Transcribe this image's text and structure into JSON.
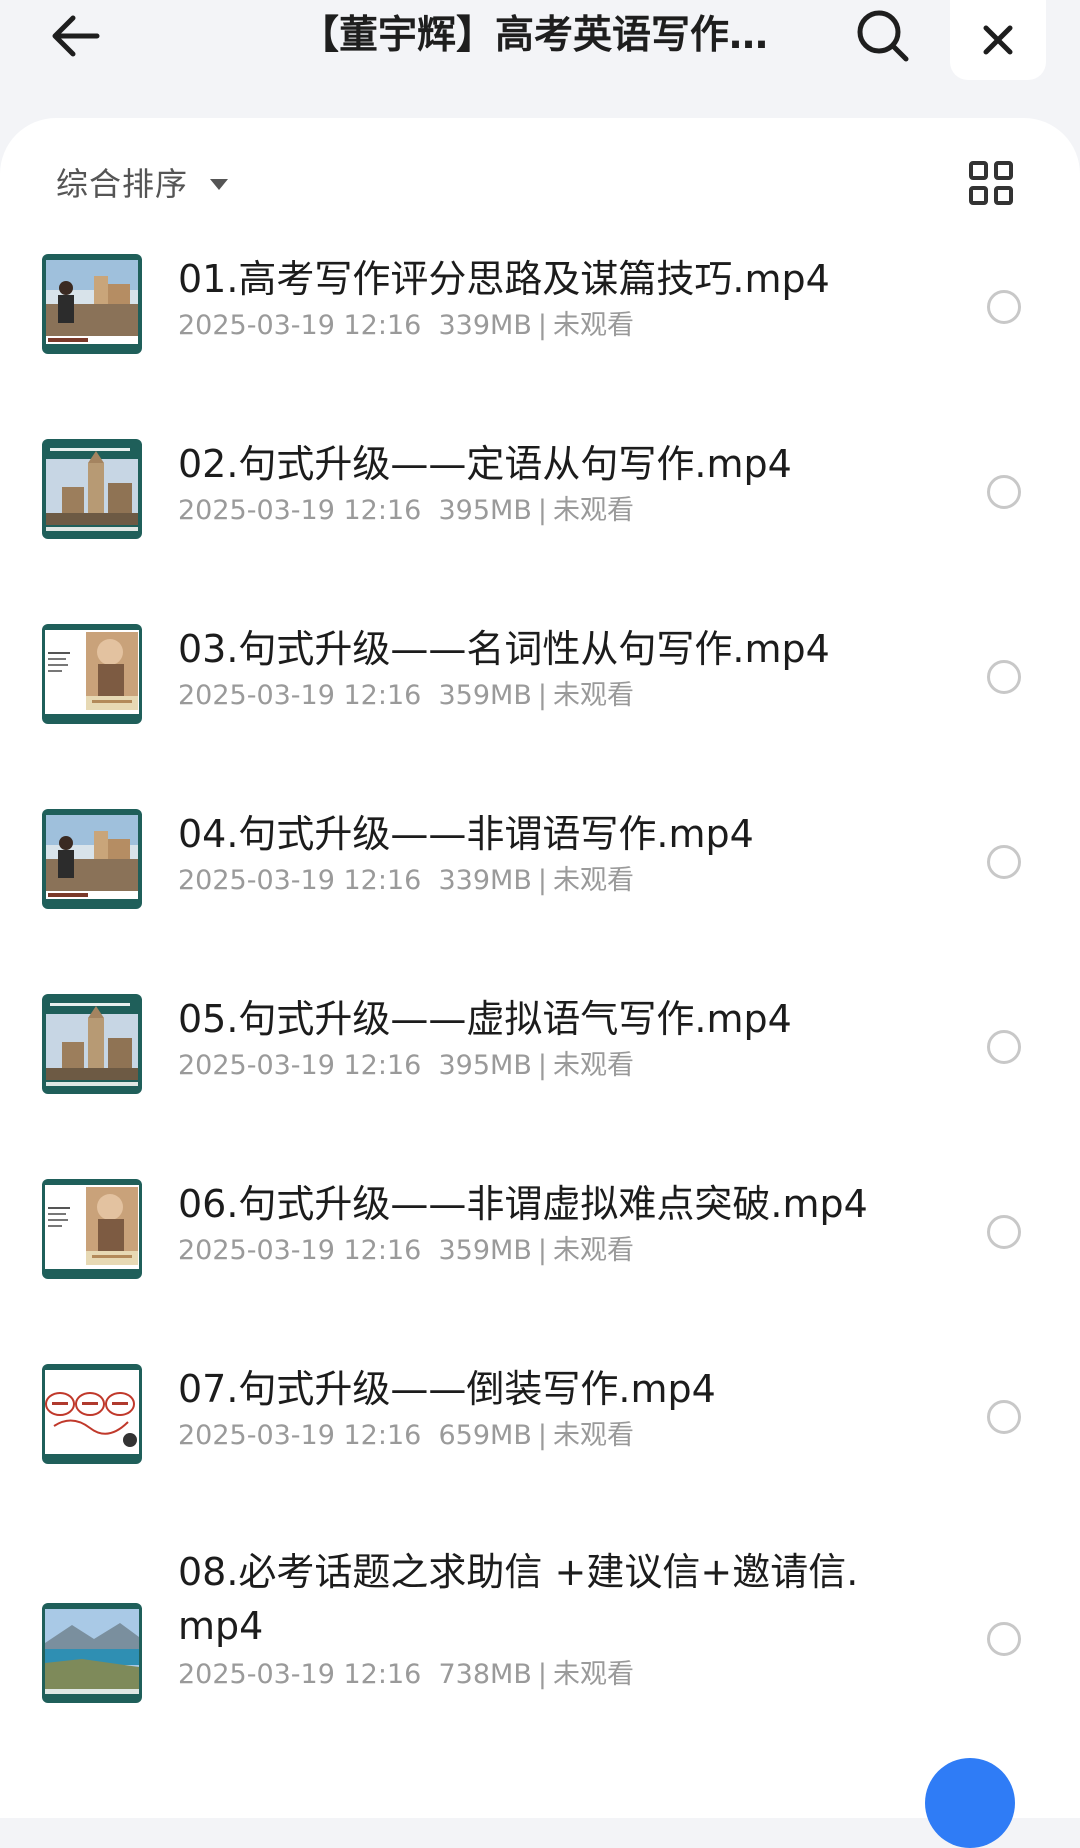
{
  "header": {
    "title": "【董宇辉】高考英语写作素材课",
    "back_icon": "back-arrow-icon",
    "search_icon": "search-icon",
    "close_icon": "close-icon"
  },
  "toolbar": {
    "sort_label": "综合排序",
    "sort_icon": "caret-down-icon",
    "view_icon": "grid-view-icon"
  },
  "files": [
    {
      "name": "01.高考写作评分思路及谋篇技巧.mp4",
      "date": "2025-03-19 12:16",
      "size": "339MB",
      "status": "未观看",
      "thumb": "teal-castle"
    },
    {
      "name": "02.句式升级——定语从句写作.mp4",
      "date": "2025-03-19 12:16",
      "size": "395MB",
      "status": "未观看",
      "thumb": "teal-cathedral"
    },
    {
      "name": "03.句式升级——名词性从句写作.mp4",
      "date": "2025-03-19 12:16",
      "size": "359MB",
      "status": "未观看",
      "thumb": "white-portrait"
    },
    {
      "name": "04.句式升级——非谓语写作.mp4",
      "date": "2025-03-19 12:16",
      "size": "339MB",
      "status": "未观看",
      "thumb": "teal-castle"
    },
    {
      "name": "05.句式升级——虚拟语气写作.mp4",
      "date": "2025-03-19 12:16",
      "size": "395MB",
      "status": "未观看",
      "thumb": "teal-cathedral"
    },
    {
      "name": "06.句式升级——非谓虚拟难点突破.mp4",
      "date": "2025-03-19 12:16",
      "size": "359MB",
      "status": "未观看",
      "thumb": "white-portrait"
    },
    {
      "name": "07.句式升级——倒装写作.mp4",
      "date": "2025-03-19 12:16",
      "size": "659MB",
      "status": "未观看",
      "thumb": "white-circles"
    },
    {
      "name": "08.必考话题之求助信 +建议信+邀请信.mp4",
      "date": "2025-03-19 12:16",
      "size": "738MB",
      "status": "未观看",
      "thumb": "teal-lake"
    }
  ],
  "colors": {
    "accent": "#2f7cf6",
    "teal": "#1f5f5a",
    "meta_text": "#9a9a9a"
  }
}
